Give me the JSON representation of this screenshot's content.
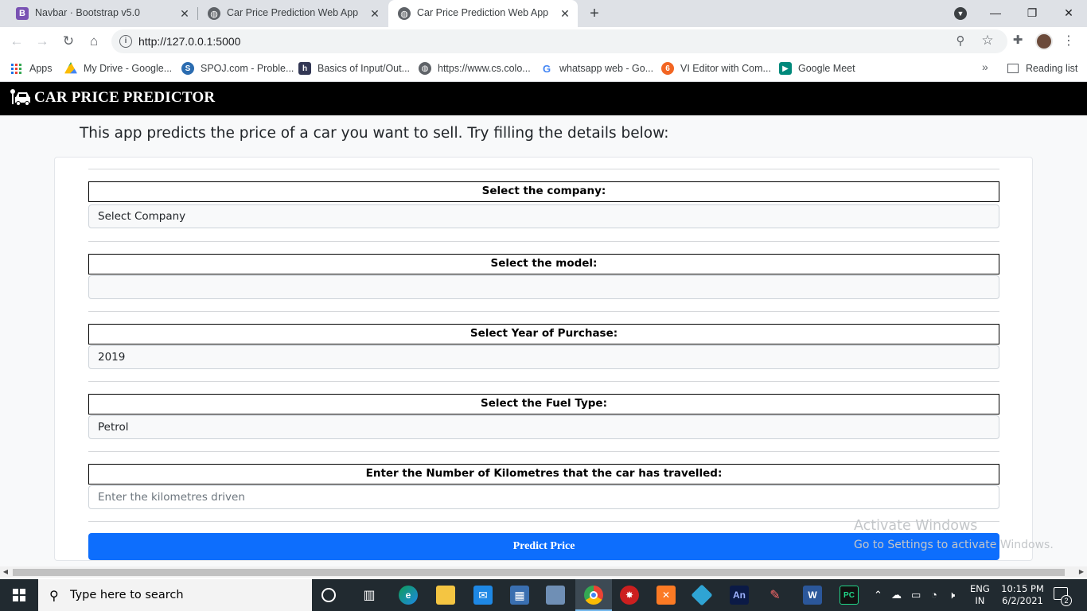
{
  "browser": {
    "tabs": [
      {
        "title": "Navbar · Bootstrap v5.0",
        "favicon": "bootstrap-icon",
        "active": false
      },
      {
        "title": "Car Price Prediction Web App",
        "favicon": "globe-icon",
        "active": false
      },
      {
        "title": "Car Price Prediction Web App",
        "favicon": "globe-icon",
        "active": true
      }
    ],
    "new_tab_label": "+",
    "url": "http://127.0.0.1:5000",
    "bookmarks": [
      {
        "label": "Apps",
        "icon": "apps-grid-icon"
      },
      {
        "label": "My Drive - Google...",
        "icon": "google-drive-icon"
      },
      {
        "label": "SPOJ.com - Proble...",
        "icon": "spoj-icon"
      },
      {
        "label": "Basics of Input/Out...",
        "icon": "hackerearth-icon"
      },
      {
        "label": "https://www.cs.colo...",
        "icon": "globe-icon"
      },
      {
        "label": "whatsapp web - Go...",
        "icon": "google-icon"
      },
      {
        "label": "VI Editor with Com...",
        "icon": "vi-editor-icon"
      },
      {
        "label": "Google Meet",
        "icon": "google-meet-icon"
      }
    ],
    "bookmarks_more": "»",
    "reading_list": "Reading list"
  },
  "site": {
    "brand": "CAR PRICE PREDICTOR",
    "lead": "This app predicts the price of a car you want to sell. Try filling the details below:",
    "fields": {
      "company": {
        "label": "Select the company:",
        "value": "Select Company"
      },
      "model": {
        "label": "Select the model:",
        "value": ""
      },
      "year": {
        "label": "Select Year of Purchase:",
        "value": "2019"
      },
      "fuel": {
        "label": "Select the Fuel Type:",
        "value": "Petrol"
      },
      "kms": {
        "label": "Enter the Number of Kilometres that the car has travelled:",
        "placeholder": "Enter the kilometres driven"
      }
    },
    "predict_button": "Predict Price"
  },
  "watermark": {
    "line1": "Activate Windows",
    "line2": "Go to Settings to activate Windows."
  },
  "taskbar": {
    "search_placeholder": "Type here to search",
    "language_line1": "ENG",
    "language_line2": "IN",
    "time": "10:15 PM",
    "date": "6/2/2021",
    "notification_count": "2"
  },
  "colors": {
    "navbar": "#000000",
    "primary_button": "#0d6efd",
    "taskbar": "#212a30"
  }
}
